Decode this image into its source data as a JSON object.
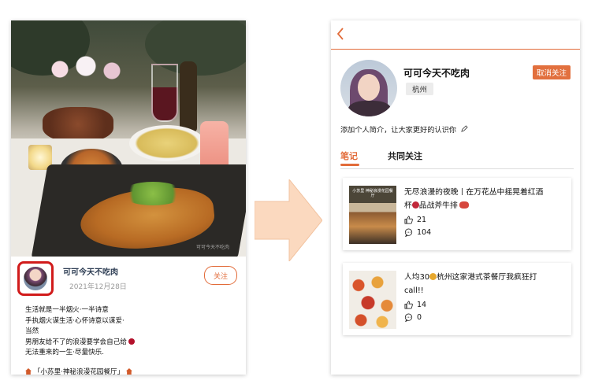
{
  "left_post": {
    "author": "可可今天不吃肉",
    "date": "2021年12月28日",
    "follow_label": "关注",
    "caption_lines": [
      "生活就是一半烟火·一半诗意",
      "手执烟火谋生活·心怀诗意以谋爱·",
      "当然",
      "男朋友给不了的浪漫要学会自己给",
      "无法重来的一生·尽量快乐."
    ],
    "location_tag": "「小苏里·神秘浪漫花园餐厅」",
    "watermark": "可可今天不吃肉"
  },
  "profile": {
    "username": "可可今天不吃肉",
    "city": "杭州",
    "unfollow_label": "取消关注",
    "bio": "添加个人简介，让大家更好的认识你",
    "tabs": [
      {
        "label": "笔记",
        "active": true
      },
      {
        "label": "共同关注",
        "active": false
      }
    ],
    "notes": [
      {
        "title_line1": "无尽浪漫的夜晚丨在万花丛中摇晃着红酒",
        "title_line2": "杯",
        "title_line2b": "品战斧牛排",
        "likes": "21",
        "comments": "104",
        "thumb_label": "小苏里 神秘浪漫花园餐厅"
      },
      {
        "title_pre": "人均30",
        "title_post": "杭州这家港式茶餐厅我疯狂打",
        "title_line2": "call!!",
        "likes": "14",
        "comments": "0"
      }
    ]
  },
  "colors": {
    "accent": "#e26b39",
    "highlight_box": "#d11b1b",
    "arrow_fill": "#fbd9bf"
  }
}
